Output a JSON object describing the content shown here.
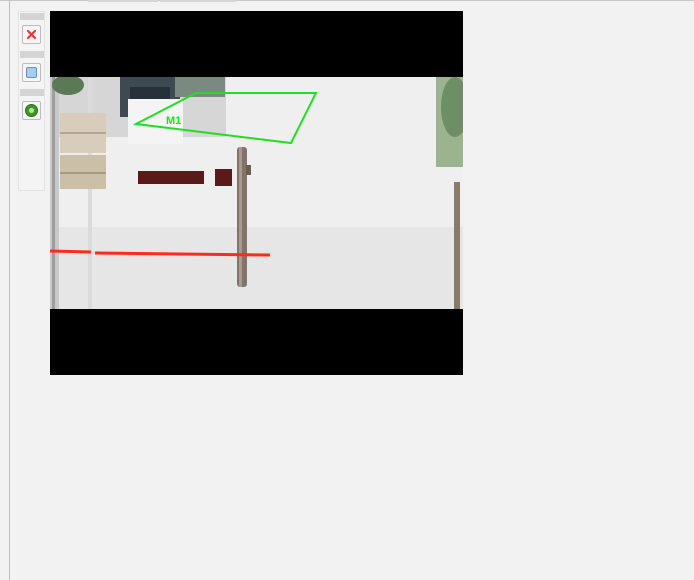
{
  "toolbar": {
    "buttons": [
      {
        "name": "delete-area-button",
        "icon": "close-icon",
        "icon_color": "#e23a3a"
      },
      {
        "name": "draw-area-button",
        "icon": "square-icon",
        "icon_color": "#7fb3e6"
      },
      {
        "name": "play-button",
        "icon": "play-circle-icon",
        "icon_color": "#3c9a24"
      }
    ]
  },
  "video": {
    "zone_label": "M1",
    "zone_color": "#22dd22",
    "line_color": "#ff2a1a"
  }
}
